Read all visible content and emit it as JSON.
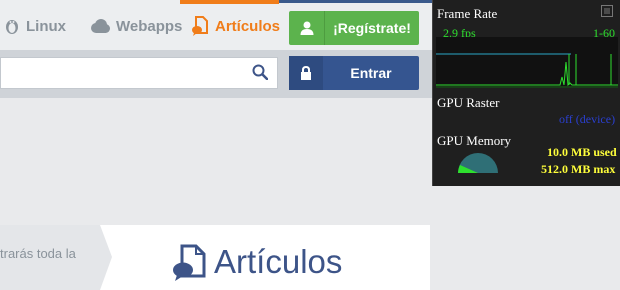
{
  "nav": {
    "items": [
      {
        "label": "Linux",
        "icon": "linux-penguin-icon"
      },
      {
        "label": "Webapps",
        "icon": "cloud-icon"
      },
      {
        "label": "Artículos",
        "icon": "document-chat-icon",
        "active": true
      }
    ]
  },
  "auth": {
    "register_label": "¡Regístrate!",
    "login_label": "Entrar"
  },
  "search": {
    "value": "",
    "icon": "search-icon"
  },
  "section": {
    "intro_text": "trarás toda la",
    "title": "Artículos",
    "icon": "document-chat-icon"
  },
  "hud": {
    "frame_rate_title": "Frame Rate",
    "fps_value": "2.9 fps",
    "fps_range": "1-60",
    "gpu_raster_title": "GPU Raster",
    "gpu_raster_status": "off (device)",
    "gpu_memory_title": "GPU Memory",
    "memory_used": "10.0 MB used",
    "memory_max": "512.0 MB max"
  },
  "colors": {
    "accent_orange": "#f07d1a",
    "register_green": "#5cb34d",
    "login_blue": "#355590",
    "title_blue": "#3d5488"
  }
}
